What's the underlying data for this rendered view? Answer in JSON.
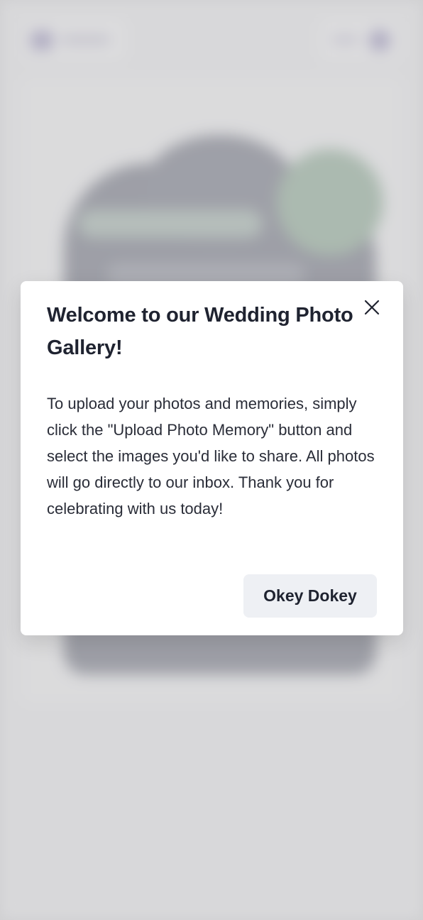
{
  "modal": {
    "title": "Welcome to our Wedding Photo Gallery!",
    "body": "To upload your photos and memories, simply click the \"Upload Photo Memory\" button and select the images you'd like to share. All photos will go directly to our inbox. Thank you for celebrating with us today!",
    "confirm_label": "Okey Dokey",
    "close_icon": "close-icon"
  },
  "colors": {
    "overlay": "#d6d6d8",
    "modal_bg": "#ffffff",
    "button_bg": "#eef0f4",
    "text": "#1f2330"
  }
}
